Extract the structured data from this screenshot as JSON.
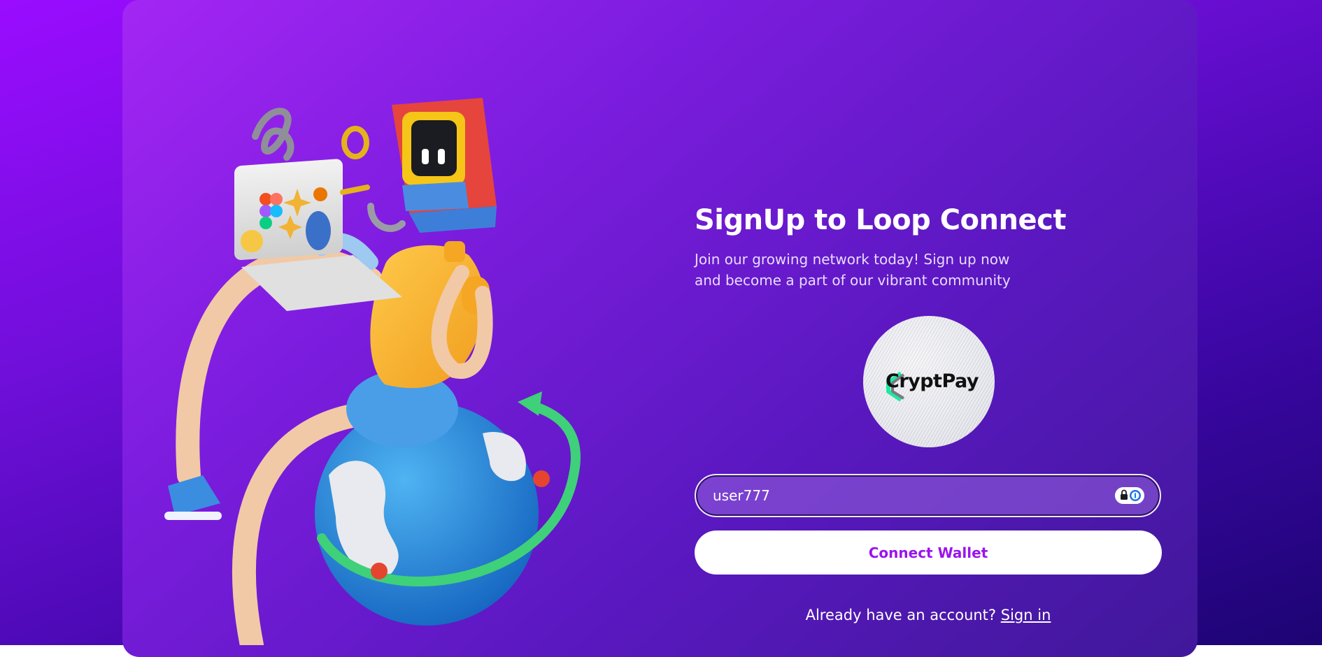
{
  "signup": {
    "title": "SignUp to Loop Connect",
    "subtitle": "Join our growing network today! Sign up now and become a part of our vibrant community"
  },
  "brand": {
    "logo_text": "CryptPay",
    "logo_accent_color": "#1de9a0"
  },
  "form": {
    "username_value": "user777",
    "password_manager_icon": "password-manager-icon",
    "connect_label": "Connect Wallet"
  },
  "footer": {
    "prompt": "Already have an account?",
    "signin_label": "Sign in"
  },
  "colors": {
    "accent": "#9a14ee",
    "background_start": "#9a0cff",
    "background_end": "#1c0473"
  }
}
